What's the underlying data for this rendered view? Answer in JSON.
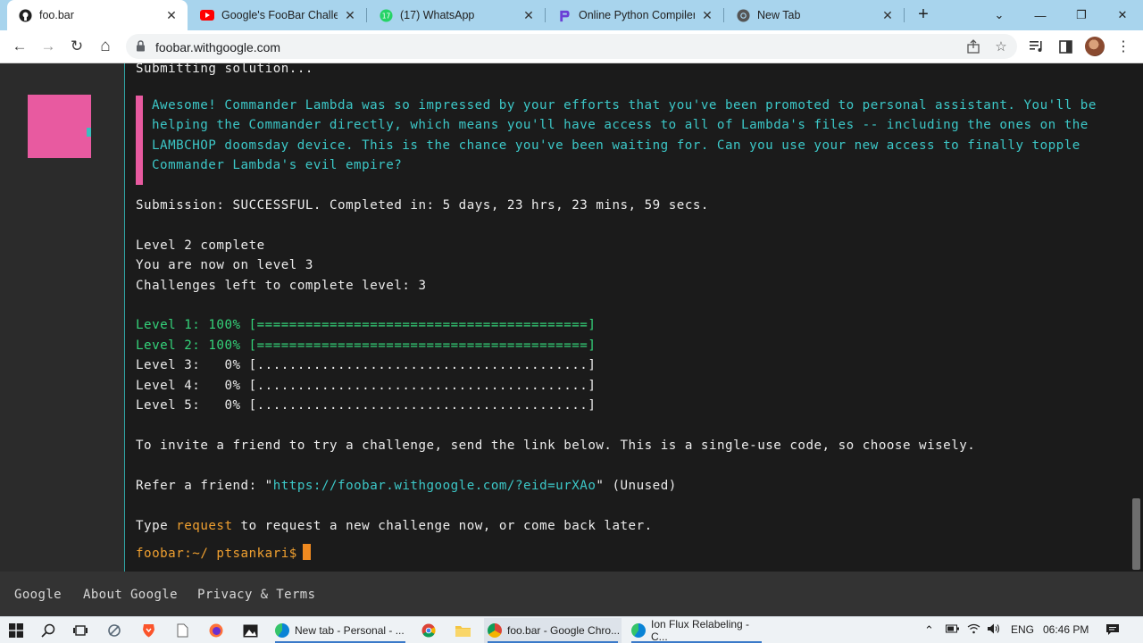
{
  "browser": {
    "tabs": [
      {
        "label": "foo.bar",
        "icon": "github-icon",
        "active": true
      },
      {
        "label": "Google's FooBar Challeng",
        "icon": "youtube-icon",
        "active": false
      },
      {
        "label": "(17) WhatsApp",
        "icon": "whatsapp-icon",
        "active": false
      },
      {
        "label": "Online Python Compiler (",
        "icon": "programiz-icon",
        "active": false
      },
      {
        "label": "New Tab",
        "icon": "chrome-icon",
        "active": false
      }
    ],
    "close_glyph": "✕",
    "new_tab_glyph": "+",
    "window_controls": {
      "dropdown": "⌄",
      "minimize": "—",
      "restore": "❐",
      "close": "✕"
    },
    "nav": {
      "back": "←",
      "forward": "→",
      "reload": "↻",
      "home": "⌂"
    },
    "url": "foobar.withgoogle.com"
  },
  "terminal": {
    "submitting": "Submitting solution...",
    "message": "Awesome! Commander Lambda was so impressed by your efforts that you've been promoted to personal assistant. You'll be helping the Commander directly, which means you'll have access to all of Lambda's files -- including the ones on the LAMBCHOP doomsday device. This is the chance you've been waiting for. Can you use your new access to finally topple Commander Lambda's evil empire?",
    "submission": "Submission: SUCCESSFUL. Completed in: 5 days, 23 hrs, 23 mins, 59 secs.",
    "level_complete": "Level 2 complete",
    "now_on": "You are now on level 3",
    "challenges_left": "Challenges left to complete level: 3",
    "levels": [
      {
        "label": "Level 1: 100% [=========================================]",
        "progress": 1.0
      },
      {
        "label": "Level 2: 100% [=========================================]",
        "progress": 1.0
      },
      {
        "label": "Level 3:   0% [.........................................]",
        "progress": 0.0
      },
      {
        "label": "Level 4:   0% [.........................................]",
        "progress": 0.0
      },
      {
        "label": "Level 5:   0% [.........................................]",
        "progress": 0.0
      }
    ],
    "invite": "To invite a friend to try a challenge, send the link below. This is a single-use code, so choose wisely.",
    "refer_prefix": "Refer a friend: \"",
    "refer_link": "https://foobar.withgoogle.com/?eid=urXAo",
    "refer_suffix": "\" (Unused)",
    "type_prefix": "Type ",
    "type_keyword": "request",
    "type_suffix": " to request a new challenge now, or come back later.",
    "prompt": "foobar:~/ ptsankari$"
  },
  "footer": {
    "links": [
      "Google",
      "About Google",
      "Privacy & Terms"
    ]
  },
  "taskbar": {
    "apps": [
      {
        "label": "New tab - Personal - ...",
        "icon": "edge-icon",
        "active": false
      },
      {
        "label": "foo.bar - Google Chro...",
        "icon": "chrome-icon",
        "active": true
      },
      {
        "label": "Ion Flux Relabeling - C...",
        "icon": "edge-icon",
        "active": false
      }
    ],
    "language": "ENG",
    "time": "06:46 PM"
  },
  "colors": {
    "accent_pink": "#e85aa0",
    "accent_teal": "#3cc8c8",
    "progress_green": "#34d37a",
    "prompt_orange": "#f0a030"
  }
}
